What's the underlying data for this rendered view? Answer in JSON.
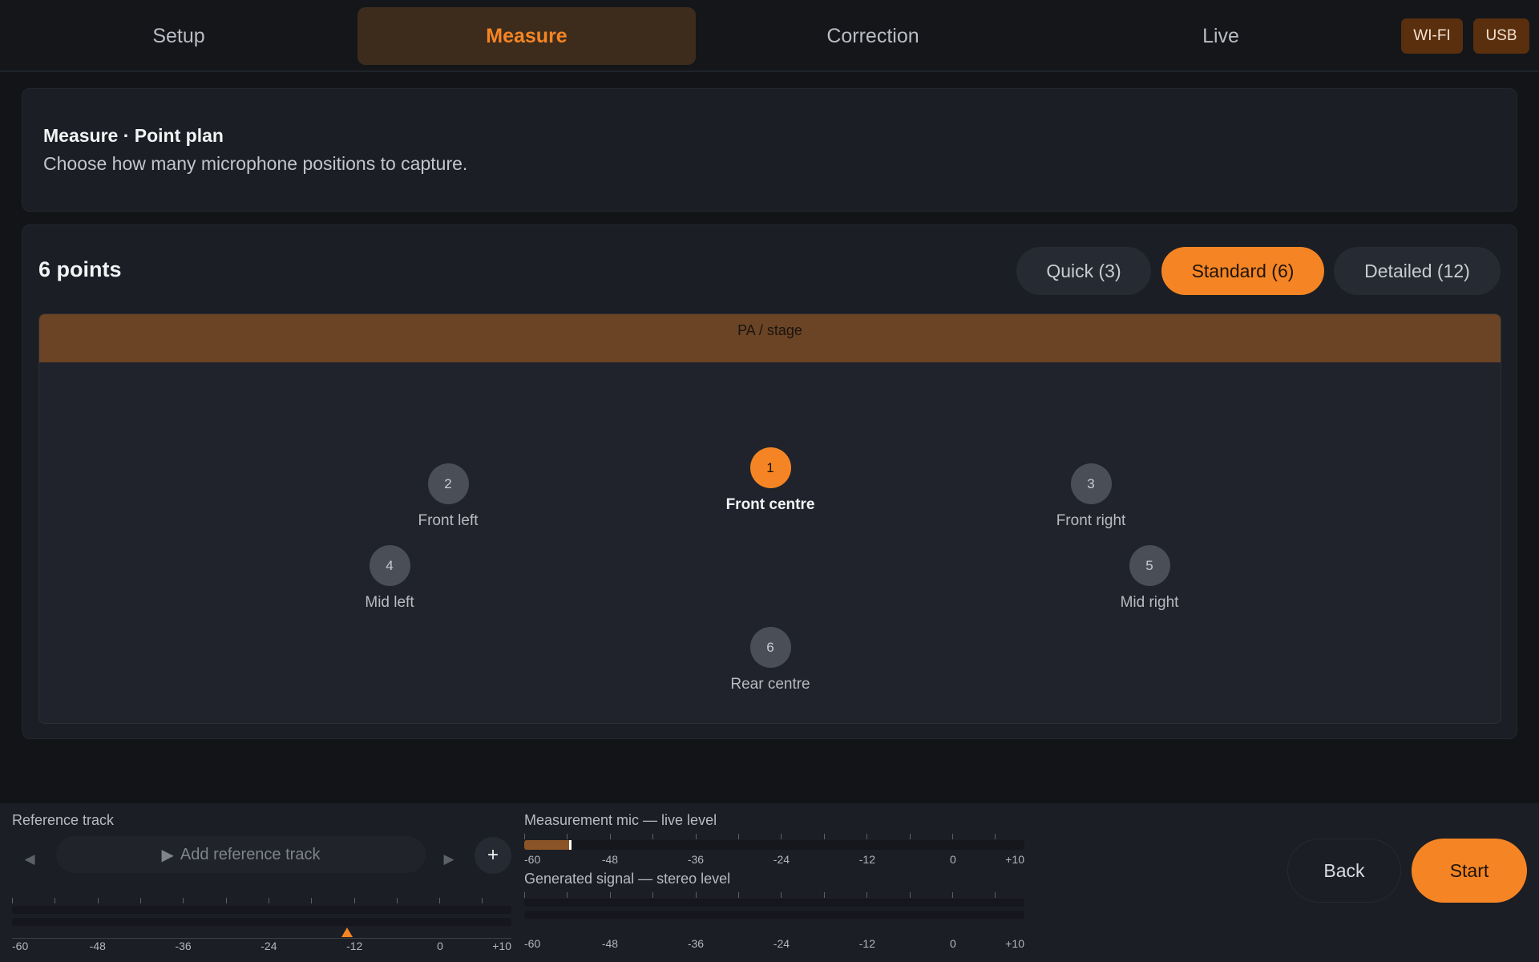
{
  "nav": {
    "tabs": [
      {
        "label": "Setup"
      },
      {
        "label": "Measure"
      },
      {
        "label": "Correction"
      },
      {
        "label": "Live"
      }
    ],
    "active_tab": "Measure",
    "badges": {
      "wifi": "WI-FI",
      "usb": "USB"
    },
    "accent_color": "#f58524"
  },
  "header": {
    "title": "Measure · Point plan",
    "subtitle": "Choose how many microphone positions to capture."
  },
  "plan": {
    "count_label": "6 points",
    "presets": [
      {
        "label": "Quick (3)"
      },
      {
        "label": "Standard (6)"
      },
      {
        "label": "Detailed (12)"
      }
    ],
    "selected_preset": "Standard (6)",
    "stage_label": "PA / stage",
    "points": [
      {
        "num": "1",
        "label": "Front centre"
      },
      {
        "num": "2",
        "label": "Front left"
      },
      {
        "num": "3",
        "label": "Front right"
      },
      {
        "num": "4",
        "label": "Mid left"
      },
      {
        "num": "5",
        "label": "Mid right"
      },
      {
        "num": "6",
        "label": "Rear centre"
      }
    ],
    "active_point": "1"
  },
  "bottom": {
    "reference": {
      "title": "Reference track",
      "prev_icon": "◀",
      "next_icon": "▶",
      "add_track_icon": "▶",
      "add_track_label": "Add reference track",
      "plus_icon": "+",
      "slider_value_db": -13
    },
    "mic_meter": {
      "title": "Measurement mic — live level",
      "level_fraction": 0.09
    },
    "signal_meter": {
      "title": "Generated signal — stereo level",
      "level_fraction": 0
    },
    "scale_labels": [
      "-60",
      "-48",
      "-36",
      "-24",
      "-12",
      "0",
      "+10"
    ],
    "back_label": "Back",
    "start_label": "Start"
  }
}
